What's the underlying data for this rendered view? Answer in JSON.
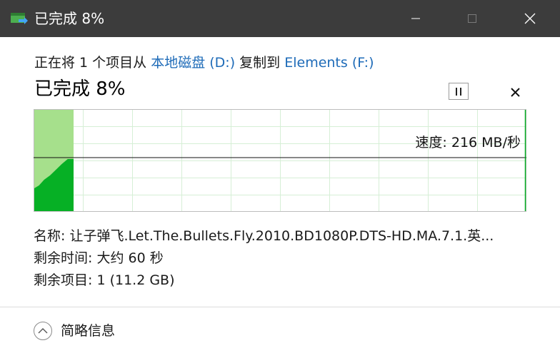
{
  "window": {
    "title": "已完成 8%"
  },
  "transfer": {
    "prefix": "正在将 1 个项目从 ",
    "source": "本地磁盘 (D:)",
    "middle": " 复制到 ",
    "destination": "Elements (F:)",
    "percent_status": "已完成 8%",
    "speed": "速度: 216 MB/秒",
    "progress_fraction": 0.08
  },
  "details": {
    "name_label": "名称:",
    "name_value": "让子弹飞.Let.The.Bullets.Fly.2010.BD1080P.DTS-HD.MA.7.1.英...",
    "time_label": "剩余时间:",
    "time_value": "大约 60 秒",
    "items_label": "剩余项目:",
    "items_value": "1 (11.2 GB)"
  },
  "footer": {
    "toggle_label": "简略信息"
  },
  "colors": {
    "titlebar": "#3c3c3c",
    "link": "#1e6bb8",
    "graph_fill_light": "#a6e08c",
    "graph_fill_dark": "#06b025",
    "graph_grid": "#d6efd6",
    "graph_border": "#06b025"
  }
}
